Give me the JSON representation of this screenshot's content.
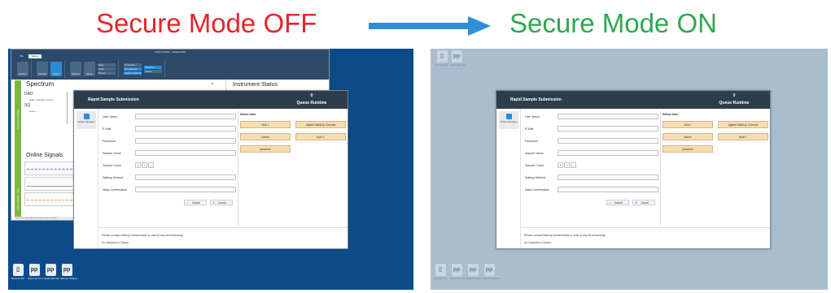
{
  "captions": {
    "off": {
      "text": "Secure Mode OFF",
      "color": "#e3262a"
    },
    "on": {
      "text": "Secure Mode ON",
      "color": "#2ea84f"
    },
    "arrow_color": "#2f8fd8"
  },
  "left_screen": {
    "desktop_icons": [
      {
        "glyph": "▯",
        "label": "Recycle Bin"
      },
      {
        "glyph": "pp",
        "label": "OpenLab Con"
      },
      {
        "glyph": "pp",
        "label": "Rapid Sample"
      },
      {
        "glyph": "pp",
        "label": "Sample Walkup"
      }
    ],
    "app": {
      "title": "1290 LC/MSD - Walkup4000",
      "tabs": [
        "File",
        "Home"
      ],
      "ribbon": {
        "big_buttons": [
          "Walkup",
          "Method",
          "Status",
          "Method",
          "Single Sample"
        ],
        "stack_one": [
          "Stop",
          "Abort",
          "Pause"
        ],
        "stack_two": [
          "Overview",
          "Run Queue",
          "Queue Runtime"
        ],
        "stack_three": [
          "Spectrum",
          "Status"
        ]
      },
      "spectrum_panel": {
        "title": "Spectrum",
        "vbar_label": "Spectrum Settings",
        "tree": [
          {
            "text": "DAD",
            "sub": false
          },
          {
            "text": "DAD: Spectrum (max)",
            "sub": true
          },
          {
            "text": "SQ",
            "sub": false
          },
          {
            "text": "Scan +",
            "sub": true
          }
        ]
      },
      "signals_panel": {
        "title": "Online Signals",
        "vbar_label": "1290 LC/MSD - 180"
      },
      "instrument_status": "Instrument Status",
      "bottom_strip": "Current User: System Administrator  Active project: Walkup"
    }
  },
  "right_screen": {
    "desktop_icons": [
      {
        "glyph": "▯",
        "label": "Recycle Bin"
      },
      {
        "glyph": "pp",
        "label": "OpenLab Con"
      },
      {
        "glyph": "pp",
        "label": "Rapid Sample"
      },
      {
        "glyph": "pp",
        "label": "Sample Walkup"
      }
    ],
    "top_icons": [
      {
        "glyph": "▯",
        "label": "Recycle Bin"
      },
      {
        "glyph": "pp",
        "label": "Rapid Sample"
      }
    ]
  },
  "dialog": {
    "title": "Rapid Sample Submission",
    "queue_count": "0",
    "queue_label": "Queue Runtime",
    "side_item": "Active Samples",
    "fields": [
      {
        "label": "User Name",
        "type": "text"
      },
      {
        "label": "E-Mail",
        "type": "text"
      },
      {
        "label": "Password",
        "type": "text"
      },
      {
        "label": "Sample Name",
        "type": "text"
      },
      {
        "label": "Sample Count",
        "type": "stepper",
        "value": "1"
      },
      {
        "label": "Walkup Method",
        "type": "text"
      },
      {
        "label": "Mass Confirmation",
        "type": "text"
      }
    ],
    "stepper_plus": "+",
    "stepper_minus": "—",
    "select_user_label": "Select User",
    "users": [
      "Bob J",
      "Agilent WalkUp Chemist",
      "Admin",
      "Kyle C",
      "lpsadmin"
    ],
    "submit_label": "Submit",
    "cancel_label": "Cancel",
    "submit_icon": "✓",
    "cancel_icon": "✕",
    "note": "Please contact WalkUp Administrator in case of any error/warnings",
    "queue_note": "No Samples in Queue"
  }
}
